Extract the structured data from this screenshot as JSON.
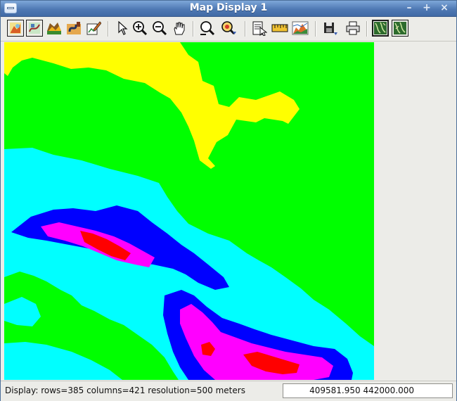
{
  "window": {
    "title": "Map Display 1"
  },
  "window_buttons": {
    "minimize": "–",
    "maximize": "+",
    "close": "×"
  },
  "toolbar": {
    "groups": [
      [
        "add-raster",
        "add-vector",
        "add-layers",
        "add-legend",
        "overlay-edit"
      ],
      [
        "pointer",
        "zoom-in",
        "zoom-out",
        "pan"
      ],
      [
        "zoom-back",
        "zoom-options"
      ],
      [
        "query",
        "measure",
        "profile"
      ],
      [
        "save",
        "print"
      ],
      [
        "2d-view",
        "3d-view"
      ]
    ]
  },
  "map": {
    "colors": {
      "background": "#00ff00",
      "upper": "#ffff00",
      "mid": "#00ffff",
      "low": "#0000ff",
      "lower": "#ff00ff",
      "lowest": "#ff0000"
    }
  },
  "status": {
    "display_info": "Display: rows=385 columns=421  resolution=500 meters",
    "coordinates": "409581.950 442000.000"
  }
}
